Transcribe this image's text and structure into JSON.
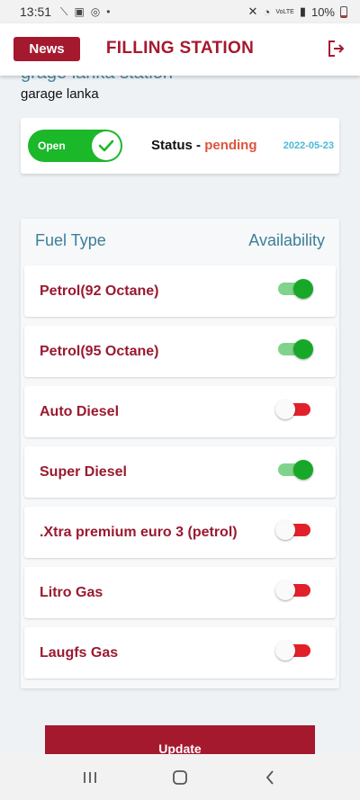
{
  "statusbar": {
    "time": "13:51",
    "battery": "10%",
    "network": "VoLTE"
  },
  "appbar": {
    "news_label": "News",
    "title": "FILLING STATION"
  },
  "station": {
    "name": "grage lanka station",
    "subtitle": "garage lanka"
  },
  "status_card": {
    "toggle_label": "Open",
    "status_label": "Status - ",
    "status_value": "pending",
    "date": "2022-05-23"
  },
  "fuel": {
    "col_type": "Fuel Type",
    "col_availability": "Availability",
    "items": [
      {
        "label": "Petrol(92 Octane)",
        "available": true
      },
      {
        "label": "Petrol(95 Octane)",
        "available": true
      },
      {
        "label": "Auto Diesel",
        "available": false
      },
      {
        "label": "Super Diesel",
        "available": true
      },
      {
        "label": ".Xtra premium euro 3 (petrol)",
        "available": false
      },
      {
        "label": "Litro Gas",
        "available": false
      },
      {
        "label": "Laugfs Gas",
        "available": false
      }
    ]
  },
  "update_label": "Update",
  "colors": {
    "brand": "#a5192f",
    "accent": "#4a8aa3",
    "on": "#17a82a",
    "off": "#e2202a",
    "pending": "#e0533b"
  }
}
